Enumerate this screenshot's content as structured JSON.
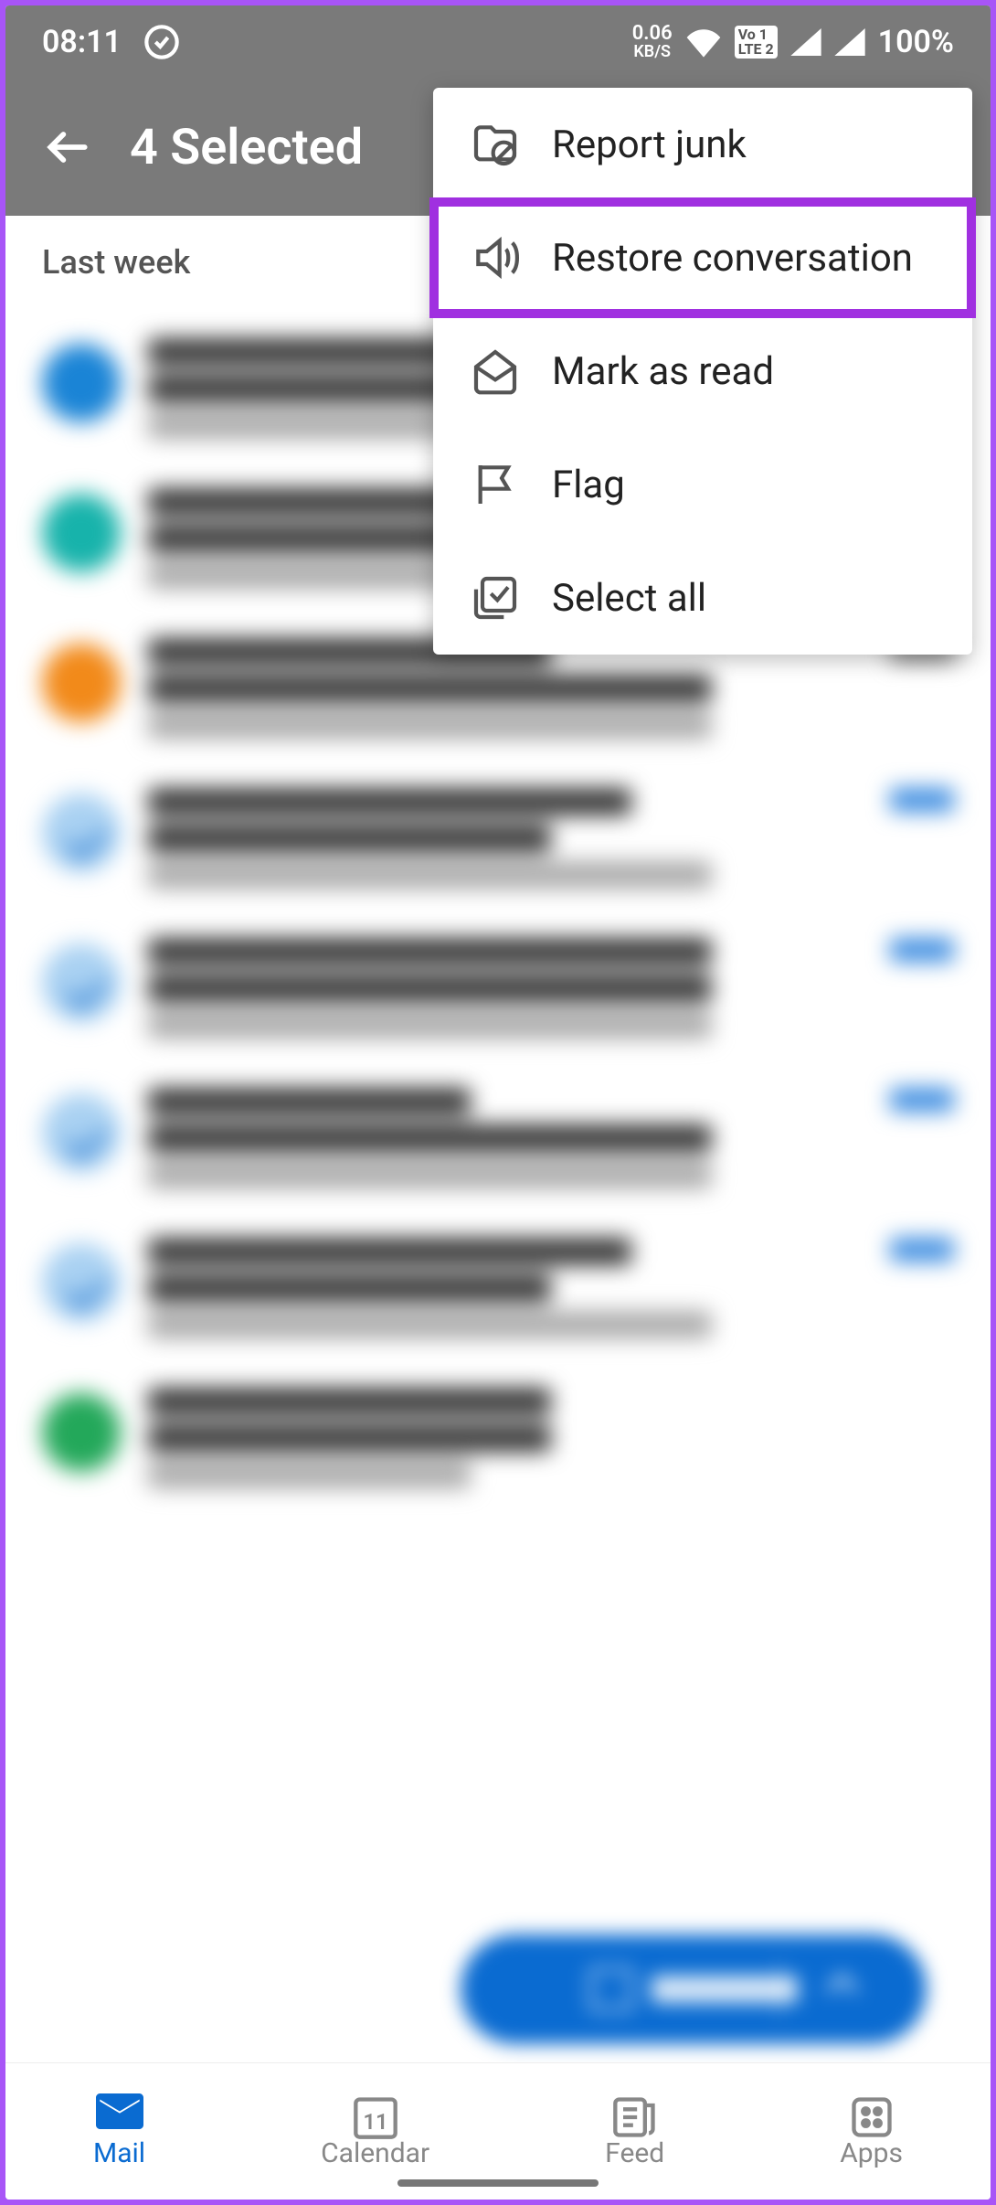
{
  "status": {
    "time": "08:11",
    "kbs_value": "0.06",
    "kbs_label": "KB/S",
    "lte": "Vo LTE 1 2",
    "battery": "100%"
  },
  "app_bar": {
    "title": "4 Selected"
  },
  "section_header": "Last week",
  "menu": {
    "items": [
      {
        "label": "Report junk",
        "icon": "folder-block"
      },
      {
        "label": "Restore conversation",
        "icon": "sound",
        "highlight": true
      },
      {
        "label": "Mark as read",
        "icon": "mail-open"
      },
      {
        "label": "Flag",
        "icon": "flag"
      },
      {
        "label": "Select all",
        "icon": "select-all"
      }
    ]
  },
  "fab": {
    "label": "New mail"
  },
  "bottom_nav": {
    "items": [
      {
        "label": "Mail",
        "icon": "mail",
        "active": true
      },
      {
        "label": "Calendar",
        "icon": "calendar",
        "badge": "11"
      },
      {
        "label": "Feed",
        "icon": "feed"
      },
      {
        "label": "Apps",
        "icon": "apps"
      }
    ]
  }
}
